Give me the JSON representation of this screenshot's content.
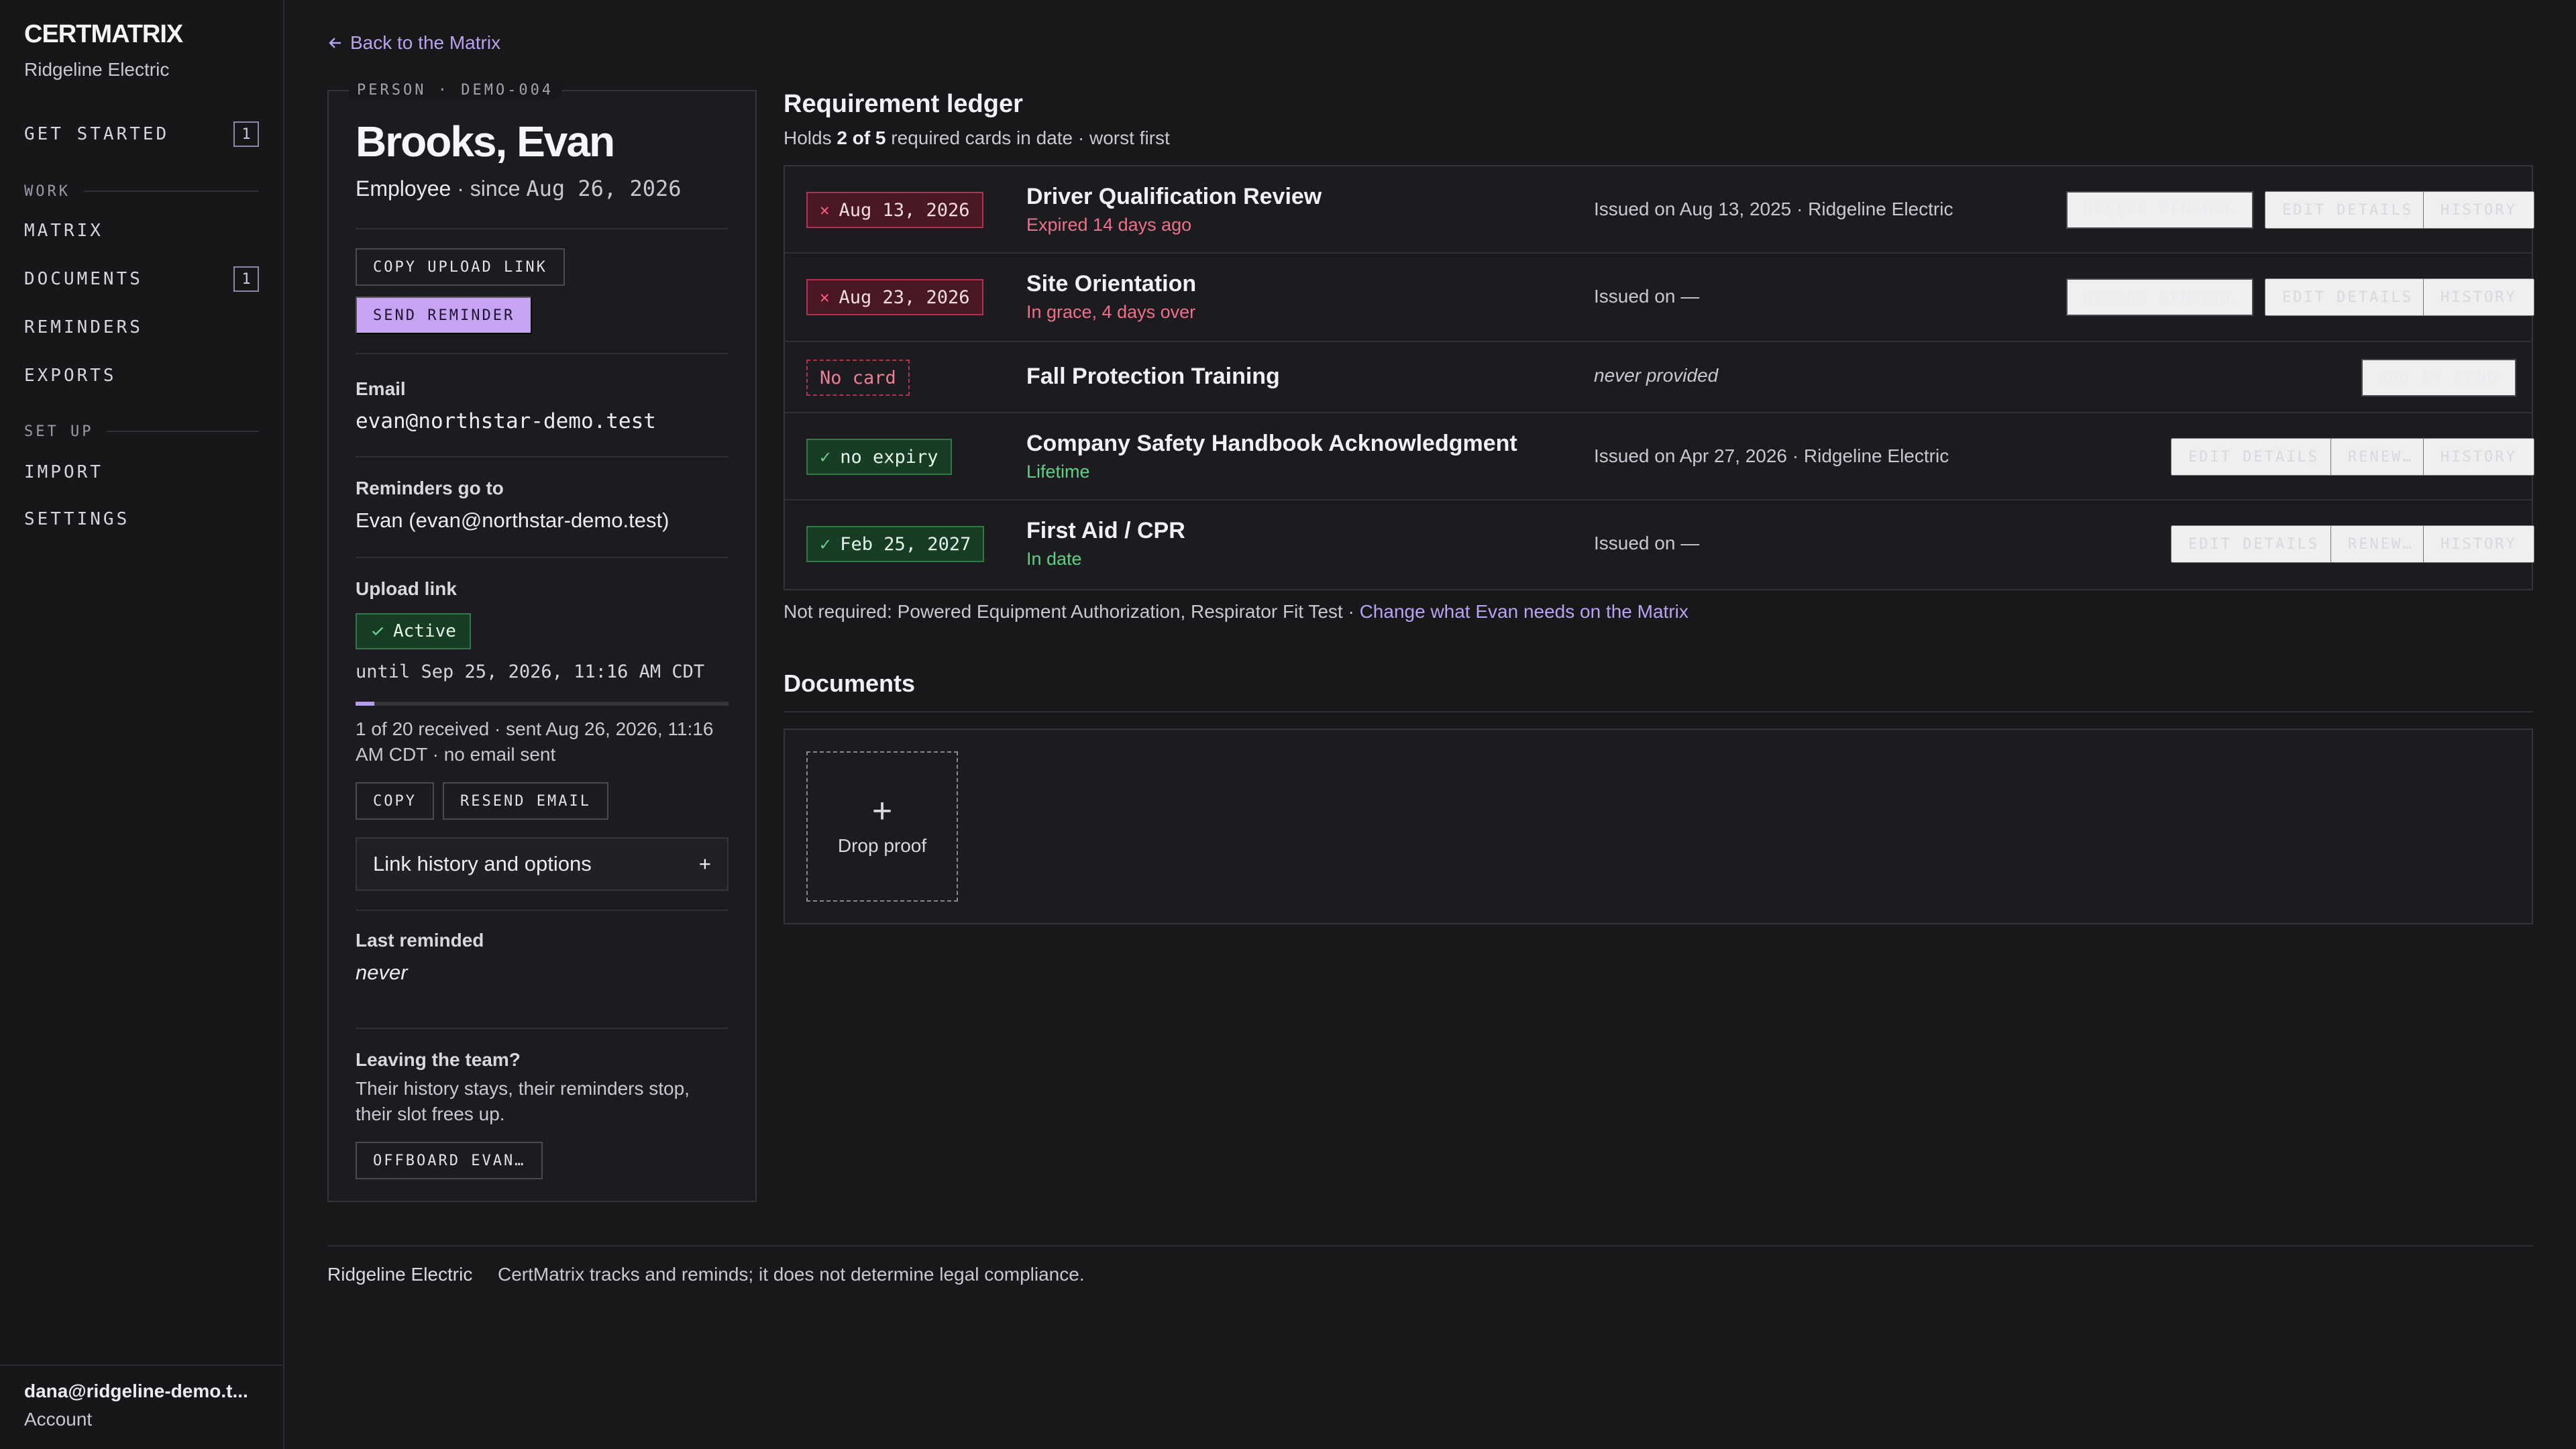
{
  "sidebar": {
    "brand": "CERTMATRIX",
    "org": "Ridgeline Electric",
    "get_started": {
      "label": "GET STARTED",
      "badge": "1"
    },
    "work_section": "WORK",
    "matrix": "MATRIX",
    "documents": {
      "label": "DOCUMENTS",
      "badge": "1"
    },
    "reminders": "REMINDERS",
    "exports": "EXPORTS",
    "setup_section": "SET UP",
    "import": "IMPORT",
    "settings": "SETTINGS",
    "account_email": "dana@ridgeline-demo.t...",
    "account_label": "Account"
  },
  "back_link": "Back to the Matrix",
  "person": {
    "tag": "PERSON · DEMO-004",
    "name": "Brooks, Evan",
    "role": "Employee",
    "since_prefix": "· since",
    "since_date": "Aug 26, 2026",
    "copy_upload_link": "COPY UPLOAD LINK",
    "send_reminder": "SEND REMINDER",
    "email_label": "Email",
    "email": "evan@northstar-demo.test",
    "reminders_label": "Reminders go to",
    "reminders_to": "Evan (evan@northstar-demo.test)",
    "upload_label": "Upload link",
    "upload_status": "Active",
    "upload_until": "until Sep 25, 2026, 11:16 AM CDT",
    "upload_progress": 0.05,
    "upload_meta": "1 of 20 received · sent Aug 26, 2026, 11:16 AM CDT · no email sent",
    "copy": "COPY",
    "resend_email": "RESEND EMAIL",
    "link_history": "Link history and options",
    "link_history_toggle": "+",
    "last_reminded_label": "Last reminded",
    "last_reminded": "never",
    "leaving_label": "Leaving the team?",
    "leaving_text": "Their history stays, their reminders stop, their slot frees up.",
    "offboard": "OFFBOARD EVAN…"
  },
  "ledger": {
    "title": "Requirement ledger",
    "sub_prefix": "Holds",
    "sub_count": "2 of 5",
    "sub_suffix": "required cards in date · worst first",
    "rows": [
      {
        "status": "Aug 13, 2026",
        "name": "Driver Qualification Review",
        "note": "Expired 14 days ago",
        "issued": "Issued on Aug 13, 2025 · Ridgeline Electric",
        "actions": [
          "RECORD RENEWAL",
          "EDIT DETAILS",
          "HISTORY"
        ]
      },
      {
        "status": "Aug 23, 2026",
        "name": "Site Orientation",
        "note": "In grace, 4 days over",
        "issued": "Issued on —",
        "actions": [
          "RECORD RENEWAL",
          "EDIT DETAILS",
          "HISTORY"
        ]
      },
      {
        "status": "No card",
        "name": "Fall Protection Training",
        "note": "",
        "issued": "never provided",
        "actions": [
          "ADD BY HAND"
        ]
      },
      {
        "status": "no expiry",
        "name": "Company Safety Handbook Acknowledgment",
        "note": "Lifetime",
        "issued": "Issued on Apr 27, 2026 · Ridgeline Electric",
        "actions": [
          "EDIT DETAILS",
          "RENEW…",
          "HISTORY"
        ]
      },
      {
        "status": "Feb 25, 2027",
        "name": "First Aid / CPR",
        "note": "In date",
        "issued": "Issued on —",
        "actions": [
          "EDIT DETAILS",
          "RENEW…",
          "HISTORY"
        ]
      }
    ],
    "not_required": "Not required: Powered Equipment Authorization, Respirator Fit Test ·",
    "change_link": "Change what Evan needs on the Matrix"
  },
  "documents": {
    "title": "Documents",
    "drop_label": "Drop proof",
    "drop_plus": "+"
  },
  "footer": {
    "org": "Ridgeline Electric",
    "note": "CertMatrix tracks and reminds; it does not determine legal compliance."
  },
  "colors": {
    "accent": "#c7a3f4",
    "expired": "#b2334f",
    "ok": "#2f7a46",
    "background": "#18181b"
  }
}
